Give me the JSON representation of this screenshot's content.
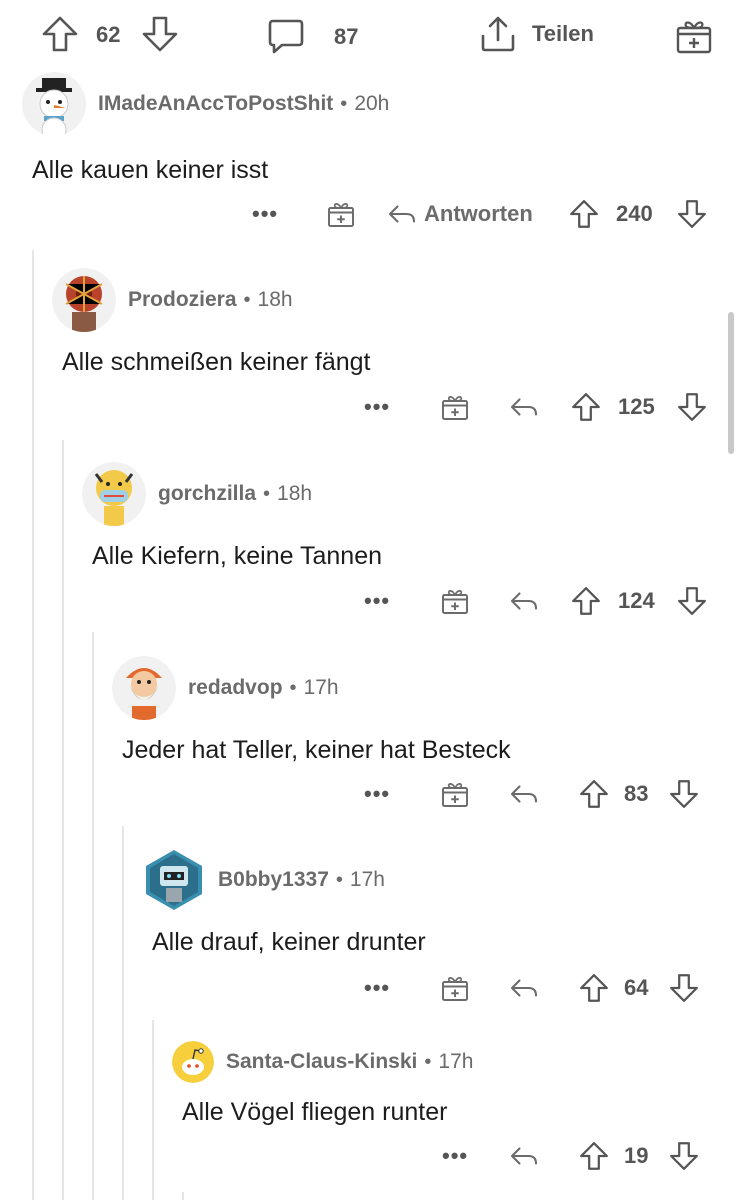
{
  "post": {
    "upvotes": "62",
    "comments": "87",
    "share_label": "Teilen"
  },
  "comments": [
    {
      "username": "IMadeAnAccToPostShit",
      "time": "20h",
      "text": "Alle kauen keiner isst",
      "more": "•••",
      "reply_label": "Antworten",
      "votes": "240"
    },
    {
      "username": "Prodoziera",
      "time": "18h",
      "text": "Alle schmeißen keiner fängt",
      "more": "•••",
      "votes": "125"
    },
    {
      "username": "gorchzilla",
      "time": "18h",
      "text": "Alle Kiefern,  keine Tannen",
      "more": "•••",
      "votes": "124"
    },
    {
      "username": "redadvop",
      "time": "17h",
      "text": "Jeder hat Teller, keiner hat Besteck",
      "more": "•••",
      "votes": "83"
    },
    {
      "username": "B0bby1337",
      "time": "17h",
      "text": "Alle drauf, keiner drunter",
      "more": "•••",
      "votes": "64"
    },
    {
      "username": "Santa-Claus-Kinski",
      "time": "17h",
      "text": "Alle Vögel fliegen runter",
      "more": "•••",
      "votes": "19"
    }
  ],
  "separator": "•",
  "icons": {
    "upvote": "arrow-up-outline-icon",
    "downvote": "arrow-down-outline-icon",
    "comment": "speech-bubble-icon",
    "share": "share-upload-icon",
    "award": "gift-award-icon",
    "reply": "reply-arrow-icon",
    "more": "more-dots-icon"
  }
}
